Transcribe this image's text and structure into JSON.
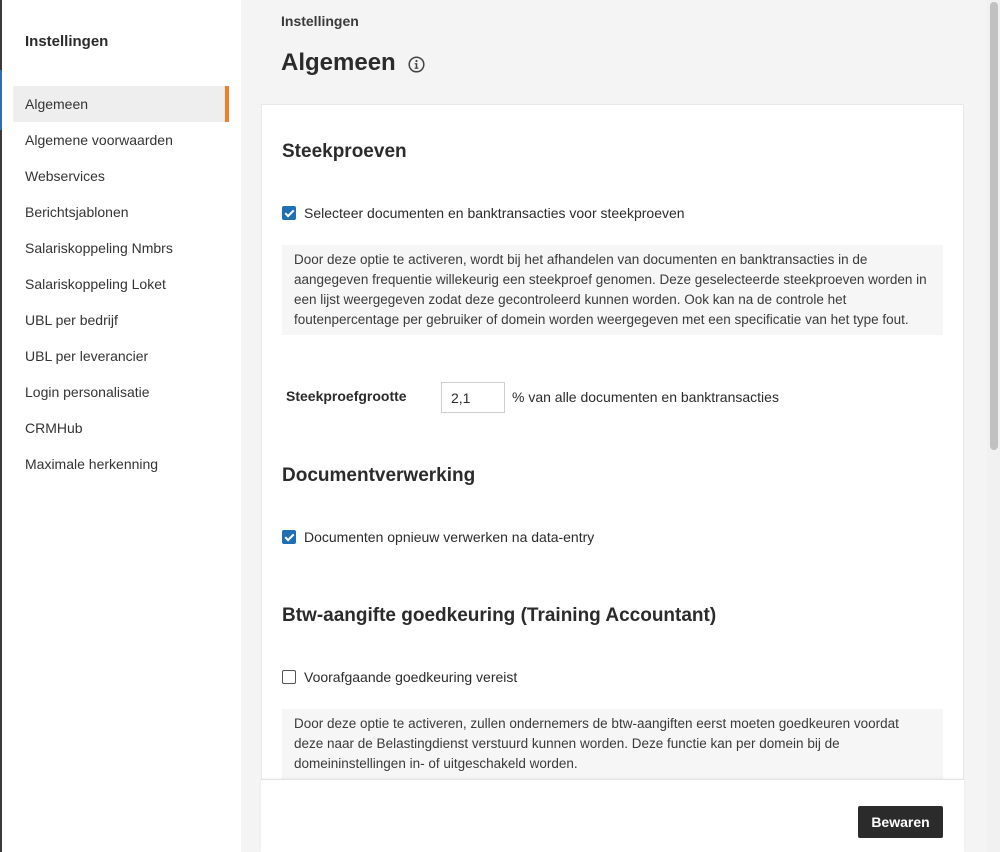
{
  "sidebar": {
    "title": "Instellingen",
    "items": [
      {
        "label": "Algemeen",
        "active": true
      },
      {
        "label": "Algemene voorwaarden"
      },
      {
        "label": "Webservices"
      },
      {
        "label": "Berichtsjablonen"
      },
      {
        "label": "Salariskoppeling Nmbrs"
      },
      {
        "label": "Salariskoppeling Loket"
      },
      {
        "label": "UBL per bedrijf"
      },
      {
        "label": "UBL per leverancier"
      },
      {
        "label": "Login personalisatie"
      },
      {
        "label": "CRMHub"
      },
      {
        "label": "Maximale herkenning"
      }
    ]
  },
  "header": {
    "breadcrumb": "Instellingen",
    "title": "Algemeen",
    "info_icon": "info-circle-icon"
  },
  "steekproeven": {
    "title": "Steekproeven",
    "checkbox_label": "Selecteer documenten en banktransacties voor steekproeven",
    "checkbox_checked": true,
    "description": "Door deze optie te activeren, wordt bij het afhandelen van documenten en banktransacties in de aangegeven frequentie willekeurig een steekproef genomen. Deze geselecteerde steekproeven worden in een lijst weergegeven zodat deze gecontroleerd kunnen worden. Ook kan na de controle het foutenpercentage per gebruiker of domein worden weergegeven met een specificatie van het type fout.",
    "size_label": "Steekproefgrootte",
    "size_value": "2,1",
    "size_suffix": "% van alle documenten en banktransacties"
  },
  "documentverwerking": {
    "title": "Documentverwerking",
    "checkbox_label": "Documenten opnieuw verwerken na data-entry",
    "checkbox_checked": true
  },
  "btw": {
    "title": "Btw-aangifte goedkeuring (Training Accountant)",
    "checkbox_label": "Voorafgaande goedkeuring vereist",
    "checkbox_checked": false,
    "description": "Door deze optie te activeren, zullen ondernemers de btw-aangiften eerst moeten goedkeuren voordat deze naar de Belastingdienst verstuurd kunnen worden. Deze functie kan per domein bij de domeininstellingen in- of uitgeschakeld worden."
  },
  "footer": {
    "save_label": "Bewaren"
  },
  "colors": {
    "accent": "#f07d2a",
    "checkbox": "#1f6fb4",
    "button": "#2b2b2b"
  }
}
